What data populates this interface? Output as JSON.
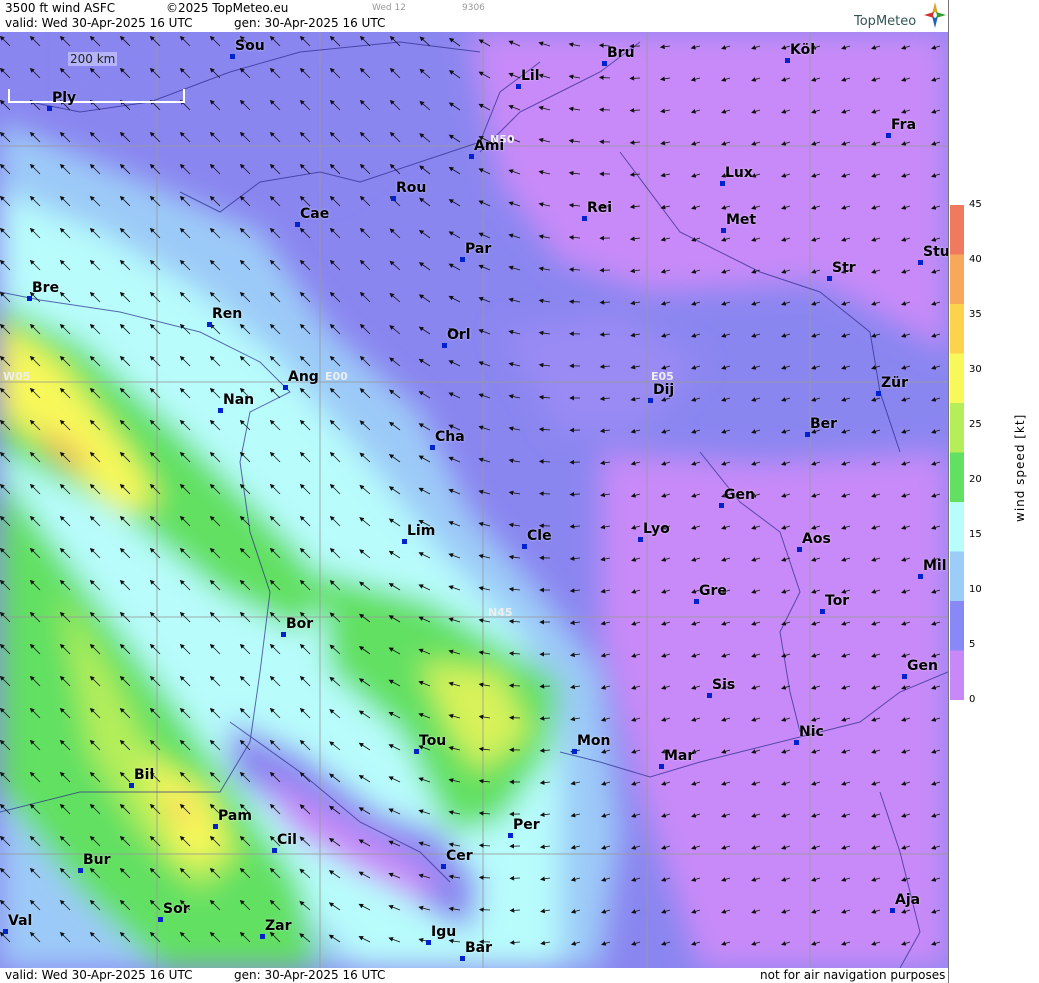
{
  "header": {
    "product": "3500 ft wind ASFC",
    "copyright": "©2025 TopMeteo.eu",
    "day_tag": "Wed 12",
    "code": "9306",
    "valid": "valid:  Wed  30-Apr-2025  16 UTC",
    "gen": "gen: 30-Apr-2025 16 UTC",
    "logo": "TopMeteo"
  },
  "footer": {
    "valid": "valid:  Wed  30-Apr-2025  16 UTC",
    "gen": "gen: 30-Apr-2025 16 UTC",
    "disclaimer": "not for air navigation purposes"
  },
  "scale_label": "200 km",
  "grid_labels": [
    "N50",
    "N45",
    "W05",
    "E00",
    "E05"
  ],
  "colorbar": {
    "title": "wind speed [kt]",
    "ticks": [
      "45",
      "40",
      "35",
      "30",
      "25",
      "20",
      "15",
      "10",
      "5",
      "0"
    ],
    "colors": [
      "#f07a60",
      "#f7a85a",
      "#fdd24c",
      "#f8f85a",
      "#b6ee5a",
      "#62e062",
      "#b8fcfc",
      "#9cccf8",
      "#8888f6",
      "#c888f8"
    ]
  },
  "cities": [
    "Sou",
    "Bru",
    "Köl",
    "Ply",
    "Lil",
    "Fra",
    "Ami",
    "Lux",
    "Rou",
    "Rei",
    "Cae",
    "Met",
    "Par",
    "Stu",
    "Str",
    "Bre",
    "Ren",
    "Orl",
    "Ang",
    "Dij",
    "Zür",
    "Nan",
    "Ber",
    "Cha",
    "Gen",
    "Lim",
    "Cle",
    "Lyo",
    "Aos",
    "Mil",
    "Gre",
    "Tor",
    "Bor",
    "Gen",
    "Sis",
    "Nic",
    "Tou",
    "Mon",
    "Mar",
    "Bil",
    "Pam",
    "Cil",
    "Per",
    "Cer",
    "Bur",
    "Sor",
    "Val",
    "Zar",
    "Igu",
    "Bar",
    "Aja"
  ]
}
